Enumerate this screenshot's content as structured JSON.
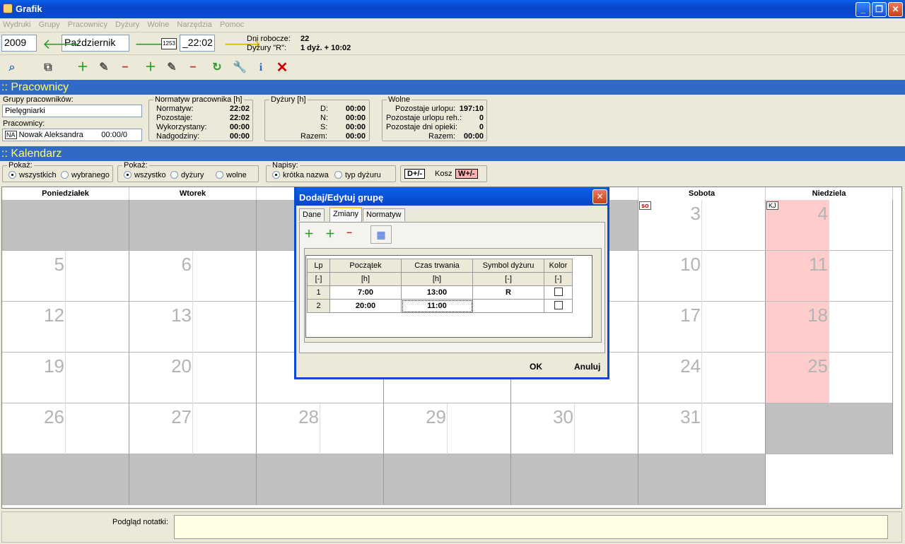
{
  "window": {
    "title": "Grafik"
  },
  "menu": [
    "Wydruki",
    "Grupy",
    "Pracownicy",
    "Dyżury",
    "Wolne",
    "Narzędzia",
    "Pomoc"
  ],
  "toolbar": {
    "year": "2009",
    "month": "Październik",
    "time": "_22:02",
    "dni_robocze_label": "Dni robocze:",
    "dni_robocze_value": "22",
    "dyzury_r_label": "Dyżury \"R\":",
    "dyzury_r_value": "1 dyż. + 10:02"
  },
  "sections": {
    "pracownicy": ":: Pracownicy",
    "kalendarz": ":: Kalendarz"
  },
  "workers": {
    "groups_label": "Grupy pracowników:",
    "group_value": "Pielęgniarki",
    "workers_label": "Pracownicy:",
    "worker_initials": "NA",
    "worker_value": "Nowak Aleksandra",
    "worker_time": "00:00/0"
  },
  "normatyw": {
    "caption": "Normatyw pracownika [h]",
    "rows": [
      {
        "label": "Normatyw:",
        "value": "22:02"
      },
      {
        "label": "Pozostaje:",
        "value": "22:02"
      },
      {
        "label": "Wykorzystany:",
        "value": "00:00"
      },
      {
        "label": "Nadgodziny:",
        "value": "00:00"
      }
    ]
  },
  "dyzury": {
    "caption": "Dyżury [h]",
    "rows": [
      {
        "label": "D:",
        "value": "00:00"
      },
      {
        "label": "N:",
        "value": "00:00"
      },
      {
        "label": "S:",
        "value": "00:00"
      },
      {
        "label": "Razem:",
        "value": "00:00"
      }
    ]
  },
  "wolne": {
    "caption": "Wolne",
    "rows": [
      {
        "label": "Pozostaje urlopu:",
        "value": "197:10"
      },
      {
        "label": "Pozostaje urlopu reh.:",
        "value": "0"
      },
      {
        "label": "Pozostaje dni opieki:",
        "value": "0"
      },
      {
        "label": "Razem:",
        "value": "00:00"
      }
    ]
  },
  "filters": {
    "pokaz1_caption": "Pokaż:",
    "pokaz1_a": "wszystkich",
    "pokaz1_b": "wybranego",
    "pokaz2_caption": "Pokaż:",
    "pokaz2_a": "wszystko",
    "pokaz2_b": "dyżury",
    "pokaz2_c": "wolne",
    "napisy_caption": "Napisy:",
    "napisy_a": "krótka nazwa",
    "napisy_b": "typ dyżuru",
    "d_btn": "D+/-",
    "kosz": "Kosz",
    "w_btn": "W+/-"
  },
  "calendar": {
    "days": [
      "Poniedziałek",
      "Wtorek",
      "",
      "",
      "",
      "Sobota",
      "Niedziela"
    ],
    "weeks": [
      [
        "",
        "",
        "",
        "",
        "",
        "3",
        "4"
      ],
      [
        "5",
        "6",
        "",
        "",
        "",
        "10",
        "11"
      ],
      [
        "12",
        "13",
        "",
        "",
        "",
        "17",
        "18"
      ],
      [
        "19",
        "20",
        "",
        "",
        "",
        "24",
        "25"
      ],
      [
        "26",
        "27",
        "28",
        "29",
        "30",
        "31",
        ""
      ]
    ],
    "tag_so": "so",
    "tag_kj": "KJ"
  },
  "note": {
    "label": "Podgląd notatki:"
  },
  "dialog": {
    "title": "Dodaj/Edytuj grupę",
    "tabs": [
      "Dane",
      "Zmiany",
      "Normatyw"
    ],
    "columns": [
      "Lp",
      "Początek",
      "Czas trwania",
      "Symbol dyżuru",
      "Kolor"
    ],
    "units": [
      "[-]",
      "[h]",
      "[h]",
      "[-]",
      "[-]"
    ],
    "rows": [
      {
        "lp": "1",
        "start": "7:00",
        "duration": "13:00",
        "symbol": "R"
      },
      {
        "lp": "2",
        "start": "20:00",
        "duration": "11:00",
        "symbol": ""
      }
    ],
    "ok": "OK",
    "cancel": "Anuluj"
  }
}
